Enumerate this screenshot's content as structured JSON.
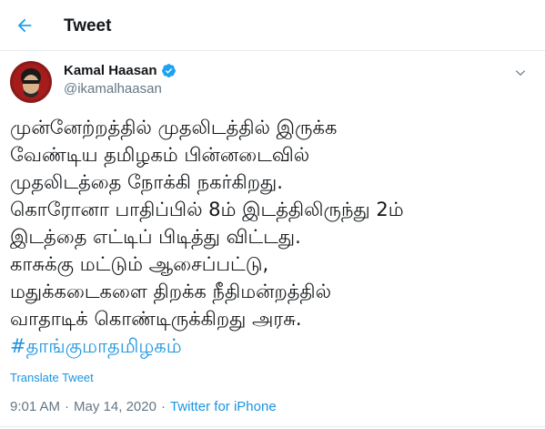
{
  "header": {
    "title": "Tweet",
    "back_icon": "arrow-left-icon"
  },
  "author": {
    "name": "Kamal Haasan",
    "handle": "@ikamalhaasan",
    "verified_icon": "verified-badge-icon",
    "more_icon": "chevron-down-icon"
  },
  "tweet": {
    "lines": [
      "முன்னேற்றத்தில் முதலிடத்தில் இருக்க",
      "வேண்டிய தமிழகம் பின்னடைவில்",
      "முதலிடத்தை நோக்கி நகர்கிறது.",
      "கொரோனா பாதிப்பில் 8ம் இடத்திலிருந்து 2ம்",
      "இடத்தை எட்டிப் பிடித்து விட்டது.",
      "காசுக்கு மட்டும் ஆசைப்பட்டு,",
      "மதுக்கடைகளை திறக்க நீதிமன்றத்தில்",
      "வாதாடிக் கொண்டிருக்கிறது அரசு."
    ],
    "hashtag": "#தாங்குமாதமிழகம்",
    "translate_label": "Translate Tweet"
  },
  "meta": {
    "time": "9:01 AM",
    "separator": "·",
    "date": "May 14, 2020",
    "source": "Twitter for iPhone"
  },
  "colors": {
    "accent": "#1b95e0",
    "muted": "#657786",
    "text": "#14171a"
  }
}
